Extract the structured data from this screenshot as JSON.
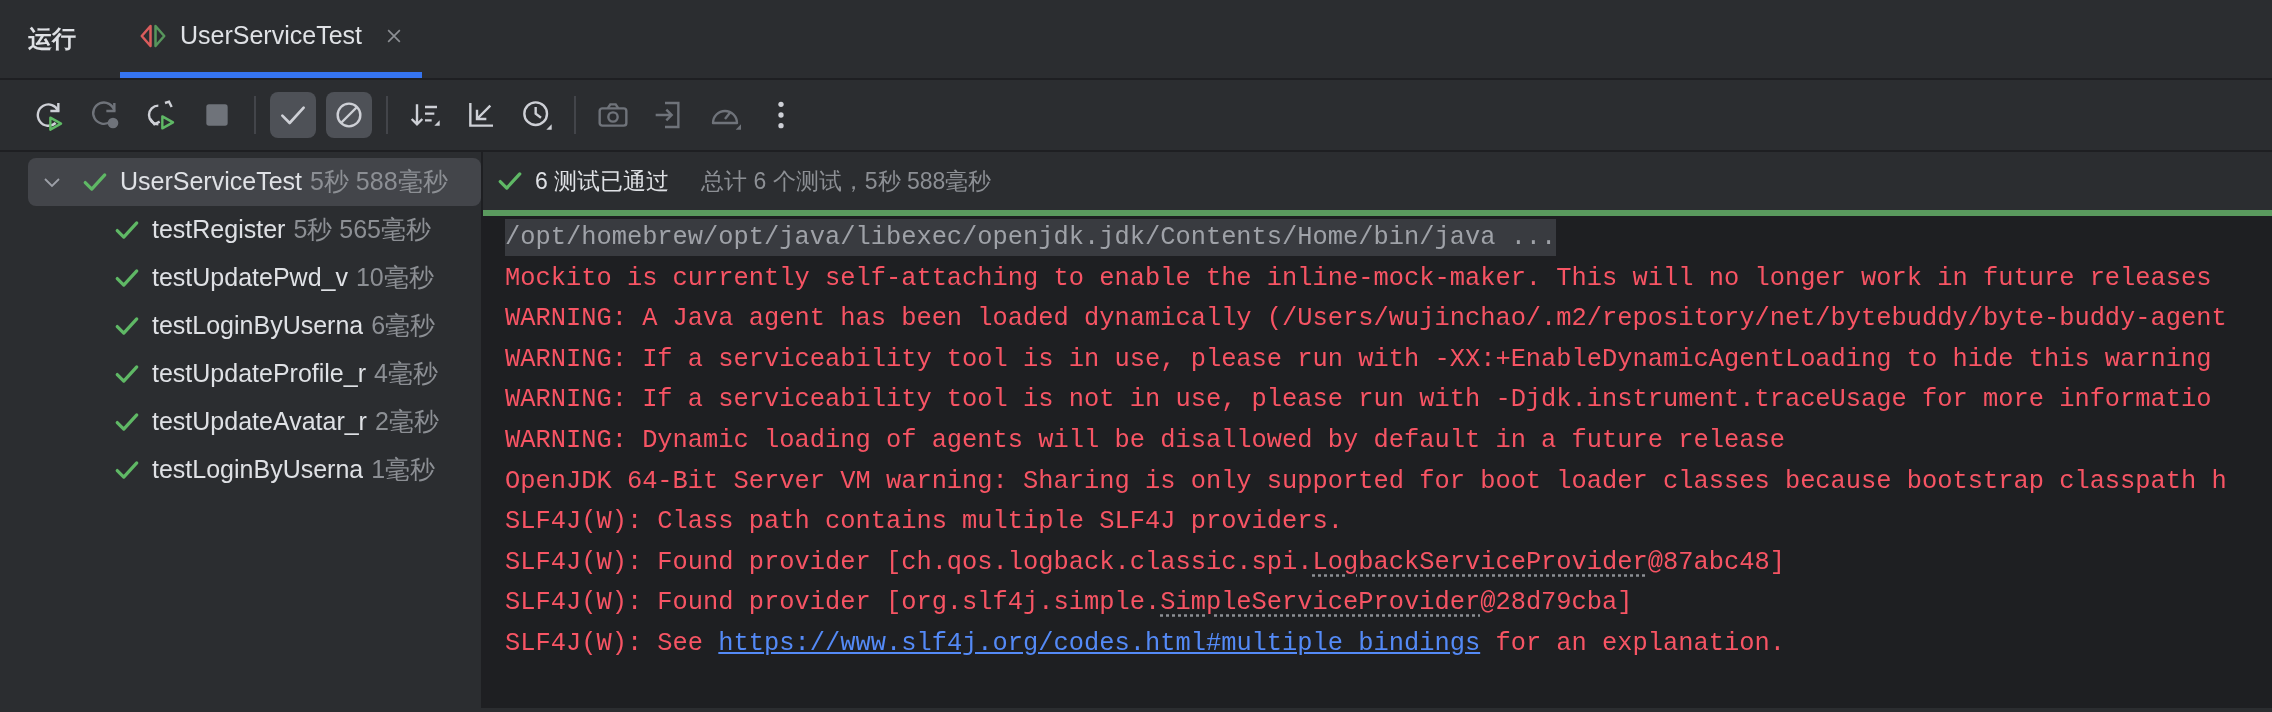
{
  "tool_window": {
    "title": "运行"
  },
  "tabs": [
    {
      "label": "UserServiceTest",
      "selected": true,
      "closable": true
    }
  ],
  "toolbar": [
    {
      "kind": "rerun",
      "disabled": false,
      "selected": false
    },
    {
      "kind": "rerun-failed",
      "disabled": true,
      "selected": false
    },
    {
      "kind": "rerun-auto",
      "disabled": false,
      "selected": false
    },
    {
      "kind": "stop",
      "disabled": true,
      "selected": false
    },
    {
      "kind": "separator"
    },
    {
      "kind": "show-passed",
      "disabled": false,
      "selected": true
    },
    {
      "kind": "show-ignored",
      "disabled": false,
      "selected": true
    },
    {
      "kind": "separator"
    },
    {
      "kind": "sort",
      "disabled": false,
      "selected": false
    },
    {
      "kind": "collapse",
      "disabled": false,
      "selected": false
    },
    {
      "kind": "history",
      "disabled": false,
      "selected": false
    },
    {
      "kind": "separator"
    },
    {
      "kind": "camera",
      "disabled": true,
      "selected": false
    },
    {
      "kind": "export",
      "disabled": true,
      "selected": false
    },
    {
      "kind": "gauge",
      "disabled": true,
      "selected": false
    },
    {
      "kind": "more",
      "disabled": false,
      "selected": false
    }
  ],
  "tree": [
    {
      "name": "UserServiceTest",
      "time": "5秒 588毫秒",
      "passed": true,
      "expanded": true,
      "selected": true,
      "children": [
        {
          "name": "testRegister",
          "time": "5秒 565毫秒",
          "passed": true,
          "selected": false
        },
        {
          "name": "testUpdatePwd_v",
          "time": "10毫秒",
          "passed": true,
          "selected": false
        },
        {
          "name": "testLoginByUserna",
          "time": "6毫秒",
          "passed": true,
          "selected": false
        },
        {
          "name": "testUpdateProfile_r",
          "time": "4毫秒",
          "passed": true,
          "selected": false
        },
        {
          "name": "testUpdateAvatar_r",
          "time": "2毫秒",
          "passed": true,
          "selected": false
        },
        {
          "name": "testLoginByUserna",
          "time": "1毫秒",
          "passed": true,
          "selected": false
        }
      ]
    }
  ],
  "summary": {
    "status": "6 测试已通过",
    "passed": true,
    "detail": "总计 6 个测试，5秒 588毫秒",
    "level": 1
  },
  "console": [
    {
      "kind": "command",
      "segments": [
        {
          "kind": "plain",
          "text": "/opt/homebrew/opt/java/libexec/openjdk.jdk/Contents/Home/bin/java ..."
        }
      ]
    },
    {
      "kind": "error",
      "segments": [
        {
          "kind": "plain",
          "text": "Mockito is currently self-attaching to enable the inline-mock-maker. This will no longer work in future releases"
        }
      ]
    },
    {
      "kind": "error",
      "segments": [
        {
          "kind": "plain",
          "text": "WARNING: A Java agent has been loaded dynamically (/Users/wujinchao/.m2/repository/net/bytebuddy/byte-buddy-agent"
        }
      ]
    },
    {
      "kind": "error",
      "segments": [
        {
          "kind": "plain",
          "text": "WARNING: If a serviceability tool is in use, please run with -XX:+EnableDynamicAgentLoading to hide this warning"
        }
      ]
    },
    {
      "kind": "error",
      "segments": [
        {
          "kind": "plain",
          "text": "WARNING: If a serviceability tool is not in use, please run with -Djdk.instrument.traceUsage for more informatio"
        }
      ]
    },
    {
      "kind": "error",
      "segments": [
        {
          "kind": "plain",
          "text": "WARNING: Dynamic loading of agents will be disallowed by default in a future release"
        }
      ]
    },
    {
      "kind": "error",
      "segments": [
        {
          "kind": "plain",
          "text": "OpenJDK 64-Bit Server VM warning: Sharing is only supported for boot loader classes because bootstrap classpath h"
        }
      ]
    },
    {
      "kind": "error",
      "segments": [
        {
          "kind": "plain",
          "text": "SLF4J(W): Class path contains multiple SLF4J providers."
        }
      ]
    },
    {
      "kind": "error",
      "segments": [
        {
          "kind": "plain",
          "text": "SLF4J(W): Found provider [ch.qos.logback.classic.spi."
        },
        {
          "kind": "reference",
          "text": "LogbackServiceProvider"
        },
        {
          "kind": "plain",
          "text": "@87abc48]"
        }
      ]
    },
    {
      "kind": "error",
      "segments": [
        {
          "kind": "plain",
          "text": "SLF4J(W): Found provider [org.slf4j.simple."
        },
        {
          "kind": "reference",
          "text": "SimpleServiceProvider"
        },
        {
          "kind": "plain",
          "text": "@28d79cba]"
        }
      ]
    },
    {
      "kind": "error",
      "segments": [
        {
          "kind": "plain",
          "text": "SLF4J(W): See "
        },
        {
          "kind": "link",
          "text": "https://www.slf4j.org/codes.html#multiple_bindings"
        },
        {
          "kind": "plain",
          "text": " for an explanation."
        }
      ]
    }
  ]
}
